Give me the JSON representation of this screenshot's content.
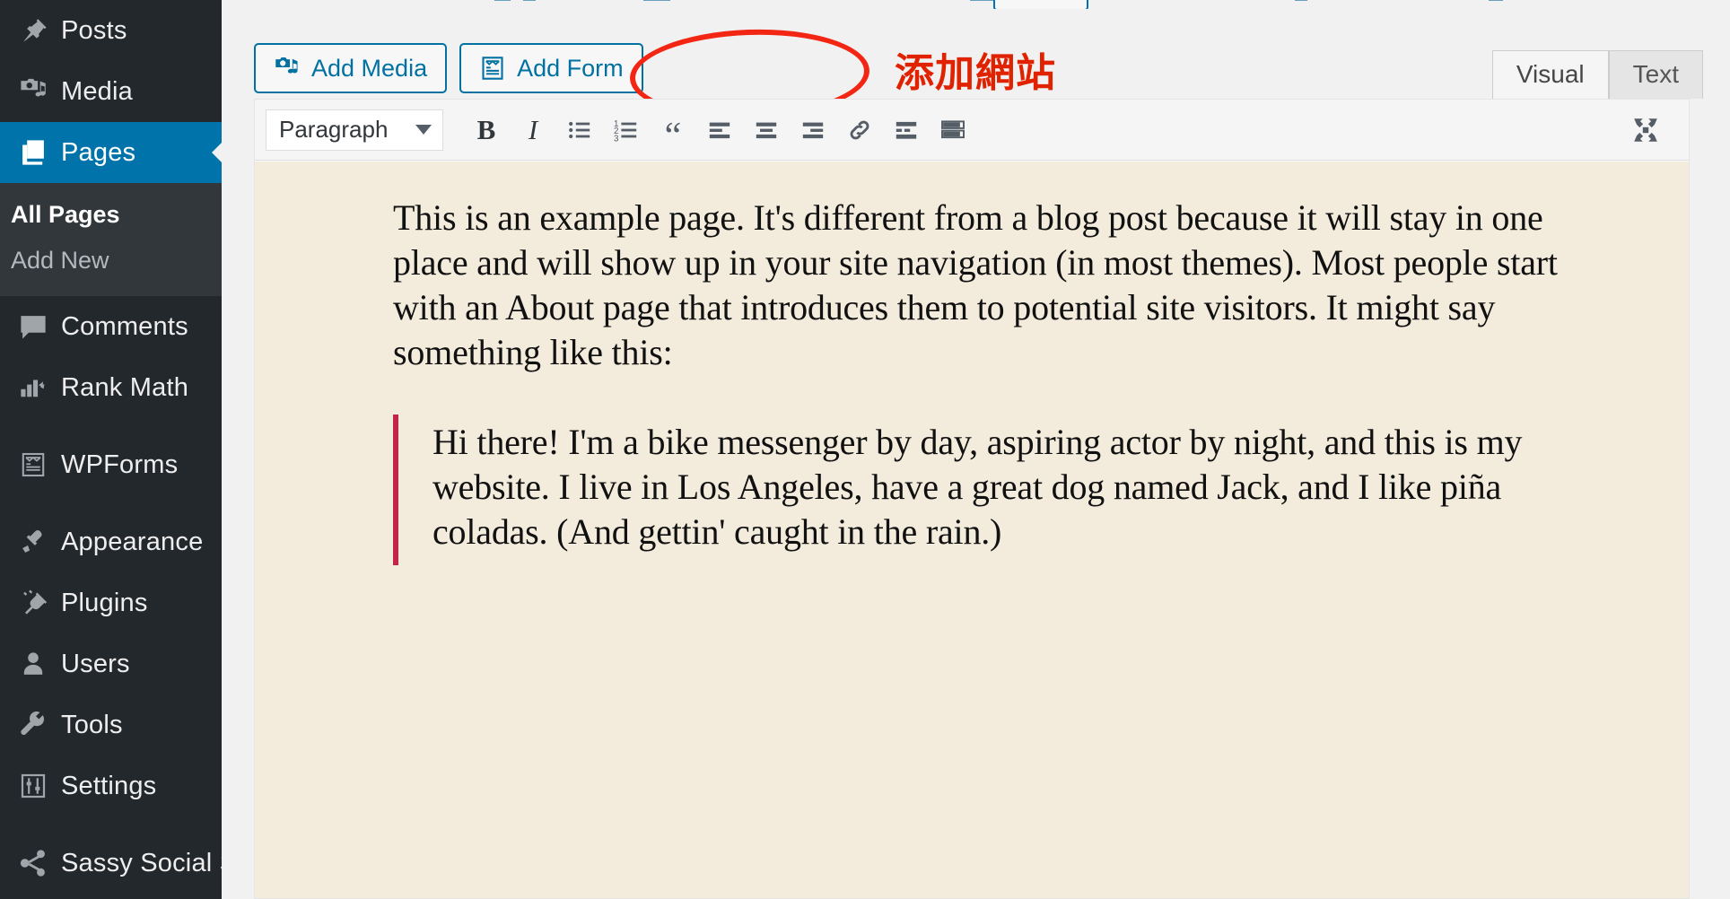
{
  "sidebar": {
    "items": [
      {
        "label": "Posts",
        "icon": "pin-icon",
        "current": false
      },
      {
        "label": "Media",
        "icon": "media-icon",
        "current": false
      },
      {
        "label": "Pages",
        "icon": "pages-icon",
        "current": true
      },
      {
        "label": "Comments",
        "icon": "comments-icon",
        "current": false
      },
      {
        "label": "Rank Math",
        "icon": "rankmath-icon",
        "current": false
      },
      {
        "label": "WPForms",
        "icon": "wpforms-icon",
        "current": false
      },
      {
        "label": "Appearance",
        "icon": "brush-icon",
        "current": false
      },
      {
        "label": "Plugins",
        "icon": "plugin-icon",
        "current": false
      },
      {
        "label": "Users",
        "icon": "user-icon",
        "current": false
      },
      {
        "label": "Tools",
        "icon": "wrench-icon",
        "current": false
      },
      {
        "label": "Settings",
        "icon": "settings-icon",
        "current": false
      },
      {
        "label": "Sassy Social Share",
        "icon": "share-icon",
        "current": false
      }
    ],
    "submenu": [
      {
        "label": "All Pages",
        "current": true
      },
      {
        "label": "Add New",
        "current": false
      }
    ],
    "colors": {
      "background": "#23282d",
      "submenu_background": "#32373c",
      "current_background": "#0073aa",
      "icon": "#a0a5aa",
      "label": "#eeeeee"
    }
  },
  "toolbar_buttons": {
    "add_media": {
      "label": "Add Media",
      "icon": "add-media-icon"
    },
    "add_form": {
      "label": "Add Form",
      "icon": "add-form-icon"
    }
  },
  "annotation": {
    "text": "添加網站",
    "shape": "ellipse",
    "color": "#e02200",
    "ellipse_color": "#f22613",
    "target": "Add Form"
  },
  "editor_tabs": [
    {
      "label": "Visual",
      "active": true
    },
    {
      "label": "Text",
      "active": false
    }
  ],
  "editor_toolbar": {
    "format_select": {
      "value": "Paragraph",
      "icon": "chevron-down-icon"
    },
    "buttons": [
      {
        "name": "bold-button",
        "glyph": "B",
        "title": "Bold"
      },
      {
        "name": "italic-button",
        "glyph": "I",
        "title": "Italic"
      },
      {
        "name": "bulleted-list-button",
        "glyph": "",
        "title": "Bulleted list"
      },
      {
        "name": "numbered-list-button",
        "glyph": "",
        "title": "Numbered list"
      },
      {
        "name": "blockquote-button",
        "glyph": "“",
        "title": "Blockquote"
      },
      {
        "name": "align-left-button",
        "glyph": "",
        "title": "Align left"
      },
      {
        "name": "align-center-button",
        "glyph": "",
        "title": "Align center"
      },
      {
        "name": "align-right-button",
        "glyph": "",
        "title": "Align right"
      },
      {
        "name": "insert-link-button",
        "glyph": "",
        "title": "Insert/edit link"
      },
      {
        "name": "read-more-button",
        "glyph": "",
        "title": "Insert Read More tag"
      },
      {
        "name": "toolbar-toggle-button",
        "glyph": "",
        "title": "Toolbar Toggle"
      }
    ],
    "fullscreen": {
      "name": "fullscreen-button",
      "title": "Distraction-free writing mode"
    }
  },
  "content": {
    "paragraph": "This is an example page. It's different from a blog post because it will stay in one place and will show up in your site navigation (in most themes). Most people start with an About page that introduces them to potential site visitors. It might say something like this:",
    "blockquote": "Hi there! I'm a bike messenger by day, aspiring actor by night, and this is my website. I live in Los Angeles, have a great dog named Jack, and I like piña coladas. (And gettin' caught in the rain.)",
    "background": "#f3ecdd",
    "blockquote_border_color": "#c2244a"
  }
}
